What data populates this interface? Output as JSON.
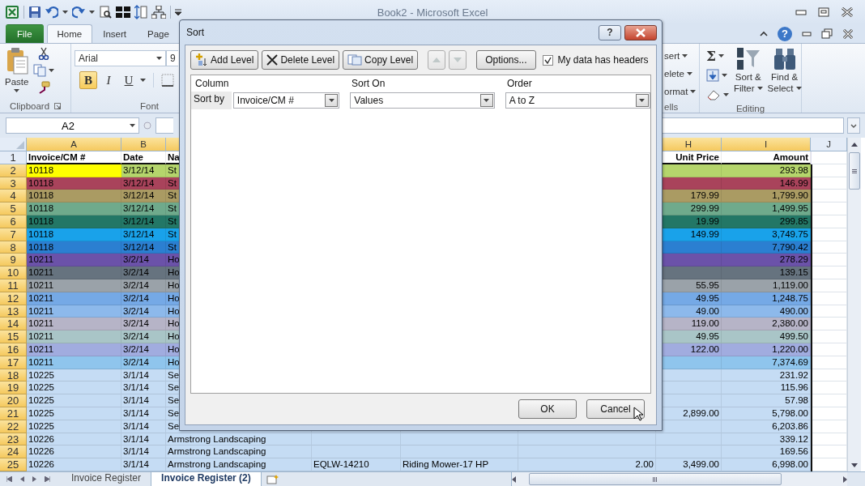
{
  "window": {
    "title": "Book2  -  Microsoft Excel"
  },
  "ribbon_tabs": [
    {
      "label": "File",
      "kind": "file",
      "selected": false
    },
    {
      "label": "Home",
      "kind": "tab",
      "selected": true
    },
    {
      "label": "Insert",
      "kind": "tab",
      "selected": false
    },
    {
      "label": "Page",
      "kind": "tab",
      "selected": false
    }
  ],
  "help_button": "?",
  "ribbon": {
    "paste": "Paste",
    "clipboard_group": "Clipboard",
    "font_name": "Arial",
    "font_size": "9",
    "format_buttons": [
      {
        "label": "B",
        "kind": "bold",
        "on": true
      },
      {
        "label": "I",
        "kind": "italic",
        "on": false
      },
      {
        "label": "U",
        "kind": "underline",
        "on": false
      }
    ],
    "font_group": "Font",
    "cells_items": [
      "sert",
      "elete",
      "ormat"
    ],
    "cells_group": "ells",
    "autosum": "Σ",
    "sort_filter": [
      "Sort &",
      "Filter"
    ],
    "find_select": [
      "Find &",
      "Select"
    ],
    "editing_group": "Editing"
  },
  "name_box": "A2",
  "sheet": {
    "columns": [
      {
        "letter": "A",
        "selected": true
      },
      {
        "letter": "B",
        "selected": true
      },
      {
        "letter": "H",
        "selected": true
      },
      {
        "letter": "I",
        "selected": true
      },
      {
        "letter": "J",
        "selected": false
      }
    ],
    "header_row": {
      "number": "1",
      "selected": false,
      "cells": {
        "a": "Invoice/CM #",
        "b": "Date",
        "c": "Na",
        "h": "Unit Price",
        "i": "Amount"
      }
    },
    "rows": [
      {
        "number": "2",
        "selected": true,
        "color": "#b5d56c",
        "first_cell": {
          "color": "#ffff00"
        },
        "cells": {
          "a": "10118",
          "b": "3/12/14",
          "c": "St",
          "i": "293.98"
        }
      },
      {
        "number": "3",
        "selected": true,
        "color": "#a9435b",
        "cells": {
          "a": "10118",
          "b": "3/12/14",
          "c": "St",
          "i": "146.99"
        }
      },
      {
        "number": "4",
        "selected": true,
        "color": "#aa9b63",
        "cells": {
          "a": "10118",
          "b": "3/12/14",
          "c": "St",
          "h": "179.99",
          "i": "1,799.90"
        }
      },
      {
        "number": "5",
        "selected": true,
        "color": "#6faa8c",
        "cells": {
          "a": "10118",
          "b": "3/12/14",
          "c": "St",
          "h": "299.99",
          "i": "1,499.95"
        }
      },
      {
        "number": "6",
        "selected": true,
        "color": "#237766",
        "cells": {
          "a": "10118",
          "b": "3/12/14",
          "c": "St",
          "h": "19.99",
          "i": "299.85"
        }
      },
      {
        "number": "7",
        "selected": true,
        "color": "#19a2ea",
        "cells": {
          "a": "10118",
          "b": "3/12/14",
          "c": "St",
          "h": "149.99",
          "i": "3,749.75"
        }
      },
      {
        "number": "8",
        "selected": true,
        "color": "#2b7fd1",
        "cells": {
          "a": "10118",
          "b": "3/12/14",
          "c": "St",
          "i": "7,790.42"
        }
      },
      {
        "number": "9",
        "selected": true,
        "color": "#6b52a9",
        "cells": {
          "a": "10211",
          "b": "3/2/14",
          "c": "Ho",
          "i": "278.29"
        }
      },
      {
        "number": "10",
        "selected": true,
        "color": "#66737f",
        "cells": {
          "a": "10211",
          "b": "3/2/14",
          "c": "Ho",
          "i": "139.15"
        }
      },
      {
        "number": "11",
        "selected": true,
        "color": "#9aa2a9",
        "cells": {
          "a": "10211",
          "b": "3/2/14",
          "c": "Ho",
          "h": "55.95",
          "i": "1,119.00"
        }
      },
      {
        "number": "12",
        "selected": true,
        "color": "#75a9e6",
        "cells": {
          "a": "10211",
          "b": "3/2/14",
          "c": "Ho",
          "h": "49.95",
          "i": "1,248.75"
        }
      },
      {
        "number": "13",
        "selected": true,
        "color": "#8db9eb",
        "cells": {
          "a": "10211",
          "b": "3/2/14",
          "c": "Ho",
          "h": "49.00",
          "i": "490.00"
        }
      },
      {
        "number": "14",
        "selected": true,
        "color": "#b6b4c7",
        "cells": {
          "a": "10211",
          "b": "3/2/14",
          "c": "Ho",
          "h": "119.00",
          "i": "2,380.00"
        }
      },
      {
        "number": "15",
        "selected": true,
        "color": "#a9c5c7",
        "cells": {
          "a": "10211",
          "b": "3/2/14",
          "c": "Ho",
          "h": "49.95",
          "i": "499.50"
        }
      },
      {
        "number": "16",
        "selected": true,
        "color": "#a1acdf",
        "cells": {
          "a": "10211",
          "b": "3/2/14",
          "c": "Ho",
          "h": "122.00",
          "i": "1,220.00"
        }
      },
      {
        "number": "17",
        "selected": true,
        "color": "#8fc5ed",
        "cells": {
          "a": "10211",
          "b": "3/2/14",
          "c": "Ho",
          "i": "7,374.69"
        }
      },
      {
        "number": "18",
        "selected": true,
        "color": "#c5dcf4",
        "cells": {
          "a": "10225",
          "b": "3/1/14",
          "c": "Se",
          "i": "231.92"
        }
      },
      {
        "number": "19",
        "selected": true,
        "color": "#c5dcf4",
        "cells": {
          "a": "10225",
          "b": "3/1/14",
          "c": "Se",
          "i": "115.96"
        }
      },
      {
        "number": "20",
        "selected": true,
        "color": "#c5dcf4",
        "cells": {
          "a": "10225",
          "b": "3/1/14",
          "c": "Se",
          "i": "57.98"
        }
      },
      {
        "number": "21",
        "selected": true,
        "color": "#c5dcf4",
        "cells": {
          "a": "10225",
          "b": "3/1/14",
          "c": "Se",
          "h": "2,899.00",
          "i": "5,798.00"
        }
      },
      {
        "number": "22",
        "selected": true,
        "color": "#c5dcf4",
        "cells": {
          "a": "10225",
          "b": "3/1/14",
          "c": "Se",
          "i": "6,203.86"
        }
      },
      {
        "number": "23",
        "selected": true,
        "color": "#c5dcf4",
        "cells": {
          "a": "10226",
          "b": "3/1/14",
          "c": "Armstrong Landscaping",
          "i": "339.12"
        }
      },
      {
        "number": "24",
        "selected": true,
        "color": "#c5dcf4",
        "cells": {
          "a": "10226",
          "b": "3/1/14",
          "c": "Armstrong Landscaping",
          "i": "169.56"
        }
      },
      {
        "number": "25",
        "selected": true,
        "color": "#c5dcf4",
        "cells": {
          "a": "10226",
          "b": "3/1/14",
          "c": "Armstrong Landscaping",
          "e": "EQLW-14210",
          "f": "Riding Mower-17 HP",
          "g": "2.00",
          "h": "3,499.00",
          "i": "6,998.00"
        }
      }
    ]
  },
  "sheet_tabs": [
    {
      "label": "Invoice Register",
      "selected": false
    },
    {
      "label": "Invoice Register (2)",
      "selected": true
    }
  ],
  "dialog": {
    "title": "Sort",
    "help_button": "?",
    "toolbar": [
      {
        "label": "Add Level",
        "kind": "add"
      },
      {
        "label": "Delete Level",
        "kind": "delete"
      },
      {
        "label": "Copy Level",
        "kind": "copy"
      }
    ],
    "move_buttons": [
      {
        "kind": "up",
        "disabled": true
      },
      {
        "kind": "down",
        "disabled": true
      }
    ],
    "options_button": "Options...",
    "headers_checkbox": {
      "label": "My data has headers",
      "checked": true
    },
    "list_headers": [
      "Column",
      "Sort On",
      "Order"
    ],
    "sort_row": {
      "label": "Sort by",
      "column": "Invoice/CM #",
      "sort_on": "Values",
      "order": "A to Z"
    },
    "buttons": [
      "OK",
      "Cancel"
    ]
  }
}
